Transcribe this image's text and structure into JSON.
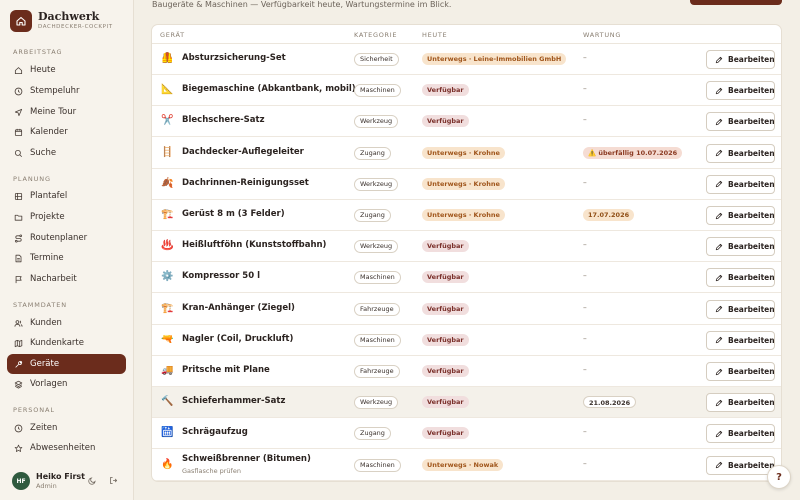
{
  "brand": {
    "title": "Dachwerk",
    "subtitle": "DACHDECKER-COCKPIT"
  },
  "sidebar": {
    "sections": [
      {
        "label": "ARBEITSTAG",
        "items": [
          {
            "label": "Heute",
            "icon": "home-icon"
          },
          {
            "label": "Stempeluhr",
            "icon": "clock-icon"
          },
          {
            "label": "Meine Tour",
            "icon": "navigation-icon"
          },
          {
            "label": "Kalender",
            "icon": "calendar-icon"
          },
          {
            "label": "Suche",
            "icon": "search-icon"
          }
        ]
      },
      {
        "label": "PLANUNG",
        "items": [
          {
            "label": "Plantafel",
            "icon": "grid-icon"
          },
          {
            "label": "Projekte",
            "icon": "folder-icon"
          },
          {
            "label": "Routenplaner",
            "icon": "route-icon"
          },
          {
            "label": "Termine",
            "icon": "document-icon"
          },
          {
            "label": "Nacharbeit",
            "icon": "flag-icon"
          }
        ]
      },
      {
        "label": "STAMMDATEN",
        "items": [
          {
            "label": "Kunden",
            "icon": "users-icon"
          },
          {
            "label": "Kundenkarte",
            "icon": "map-icon"
          },
          {
            "label": "Geräte",
            "icon": "tool-icon",
            "active": true
          },
          {
            "label": "Vorlagen",
            "icon": "layers-icon"
          }
        ]
      },
      {
        "label": "PERSONAL",
        "items": [
          {
            "label": "Zeiten",
            "icon": "clock-icon"
          },
          {
            "label": "Abwesenheiten",
            "icon": "star-icon"
          }
        ]
      }
    ],
    "user": {
      "initials": "HF",
      "name": "Heiko First",
      "role": "Admin"
    }
  },
  "main": {
    "subtitle": "Baugeräte & Maschinen — Verfügbarkeit heute, Wartungstermine im Blick.",
    "columns": {
      "geraet": "GERÄT",
      "kategorie": "KATEGORIE",
      "heute": "HEUTE",
      "wartung": "WARTUNG"
    },
    "edit_label": "Bearbeiten",
    "rows": [
      {
        "icon": "🦺",
        "name": "Absturzsicherung-Set",
        "kategorie": "Sicherheit",
        "status": "Unterwegs · Leine-Immobilien GmbH",
        "status_kind": "out",
        "wartung": "–",
        "wartung_kind": "none"
      },
      {
        "icon": "📐",
        "name": "Biegemaschine (Abkantbank, mobil)",
        "kategorie": "Maschinen",
        "status": "Verfügbar",
        "status_kind": "ok",
        "wartung": "–",
        "wartung_kind": "none"
      },
      {
        "icon": "✂️",
        "name": "Blechschere-Satz",
        "kategorie": "Werkzeug",
        "status": "Verfügbar",
        "status_kind": "ok",
        "wartung": "–",
        "wartung_kind": "none"
      },
      {
        "icon": "🪜",
        "name": "Dachdecker-Auflegeleiter",
        "kategorie": "Zugang",
        "status": "Unterwegs · Krohne",
        "status_kind": "out",
        "wartung": "⚠️ überfällig 10.07.2026",
        "wartung_kind": "due"
      },
      {
        "icon": "🍂",
        "name": "Dachrinnen-Reinigungsset",
        "kategorie": "Werkzeug",
        "status": "Unterwegs · Krohne",
        "status_kind": "out",
        "wartung": "–",
        "wartung_kind": "none"
      },
      {
        "icon": "🏗️",
        "name": "Gerüst 8 m (3 Felder)",
        "kategorie": "Zugang",
        "status": "Unterwegs · Krohne",
        "status_kind": "out",
        "wartung": "17.07.2026",
        "wartung_kind": "date"
      },
      {
        "icon": "♨️",
        "name": "Heißluftföhn (Kunststoffbahn)",
        "kategorie": "Werkzeug",
        "status": "Verfügbar",
        "status_kind": "ok",
        "wartung": "–",
        "wartung_kind": "none"
      },
      {
        "icon": "⚙️",
        "name": "Kompressor 50 l",
        "kategorie": "Maschinen",
        "status": "Verfügbar",
        "status_kind": "ok",
        "wartung": "–",
        "wartung_kind": "none"
      },
      {
        "icon": "🏗️",
        "name": "Kran-Anhänger (Ziegel)",
        "kategorie": "Fahrzeuge",
        "status": "Verfügbar",
        "status_kind": "ok",
        "wartung": "–",
        "wartung_kind": "none"
      },
      {
        "icon": "🔫",
        "name": "Nagler (Coil, Druckluft)",
        "kategorie": "Maschinen",
        "status": "Verfügbar",
        "status_kind": "ok",
        "wartung": "–",
        "wartung_kind": "none"
      },
      {
        "icon": "🚚",
        "name": "Pritsche mit Plane",
        "kategorie": "Fahrzeuge",
        "status": "Verfügbar",
        "status_kind": "ok",
        "wartung": "–",
        "wartung_kind": "none"
      },
      {
        "icon": "🔨",
        "name": "Schieferhammer-Satz",
        "kategorie": "Werkzeug",
        "status": "Verfügbar",
        "status_kind": "ok",
        "wartung": "21.08.2026",
        "wartung_kind": "plain",
        "highlight": true
      },
      {
        "icon": "🛗",
        "name": "Schrägaufzug",
        "kategorie": "Zugang",
        "status": "Verfügbar",
        "status_kind": "ok",
        "wartung": "–",
        "wartung_kind": "none"
      },
      {
        "icon": "🔥",
        "name": "Schweißbrenner (Bitumen)",
        "sub": "Gasflasche prüfen",
        "kategorie": "Maschinen",
        "status": "Unterwegs · Nowak",
        "status_kind": "out",
        "wartung": "–",
        "wartung_kind": "none"
      }
    ]
  },
  "help_label": "?",
  "colors": {
    "accent": "#6b2c1c",
    "status_ok_bg": "#f1dede",
    "status_out_bg": "#f8e4cc",
    "avatar": "#2f5a3f"
  }
}
